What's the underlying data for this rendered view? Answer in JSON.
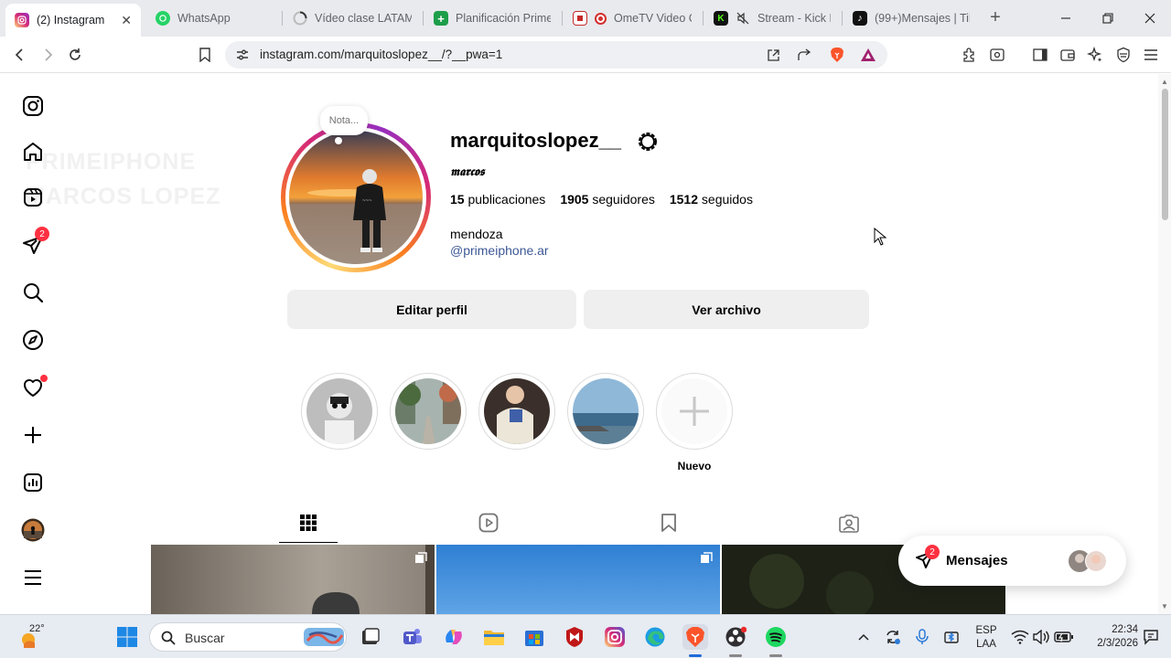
{
  "browser": {
    "tabs": [
      {
        "title": "(2) Instagram",
        "active": true
      },
      {
        "title": "WhatsApp"
      },
      {
        "title": "Vídeo clase LATAM"
      },
      {
        "title": "Planificación Prime"
      },
      {
        "title": "OmeTV Video C"
      },
      {
        "title": "Stream - Kick D"
      },
      {
        "title": "(99+)Mensajes | Tik"
      }
    ],
    "close_glyph": "✕",
    "new_tab_glyph": "+",
    "url": "instagram.com/marquitoslopez__/?__pwa=1"
  },
  "instagram": {
    "nav": {
      "notifications_badge": "2"
    },
    "ghost_text": [
      "PRIMEIPHONE",
      "MARCOS LOPEZ"
    ],
    "profile": {
      "note": "Nota...",
      "username": "marquitoslopez__",
      "fullname": "𝖒𝖆𝖗𝖈𝖔𝖘",
      "stats": {
        "posts_count": "15",
        "posts_label": "publicaciones",
        "followers_count": "1905",
        "followers_label": "seguidores",
        "following_count": "1512",
        "following_label": "seguidos"
      },
      "bio": "mendoza",
      "bio_link": "@primeiphone.ar",
      "edit_button": "Editar perfil",
      "archive_button": "Ver archivo",
      "new_highlight_label": "Nuevo"
    },
    "messages": {
      "label": "Mensajes",
      "badge": "2"
    }
  },
  "taskbar": {
    "weather": "22°",
    "search_placeholder": "Buscar",
    "language_top": "ESP",
    "language_bottom": "LAA",
    "time": "22:34",
    "date": "2/3/2026"
  },
  "colors": {
    "accent_link": "#3d5896",
    "badge": "#ff3040",
    "button_bg": "#efefef"
  }
}
